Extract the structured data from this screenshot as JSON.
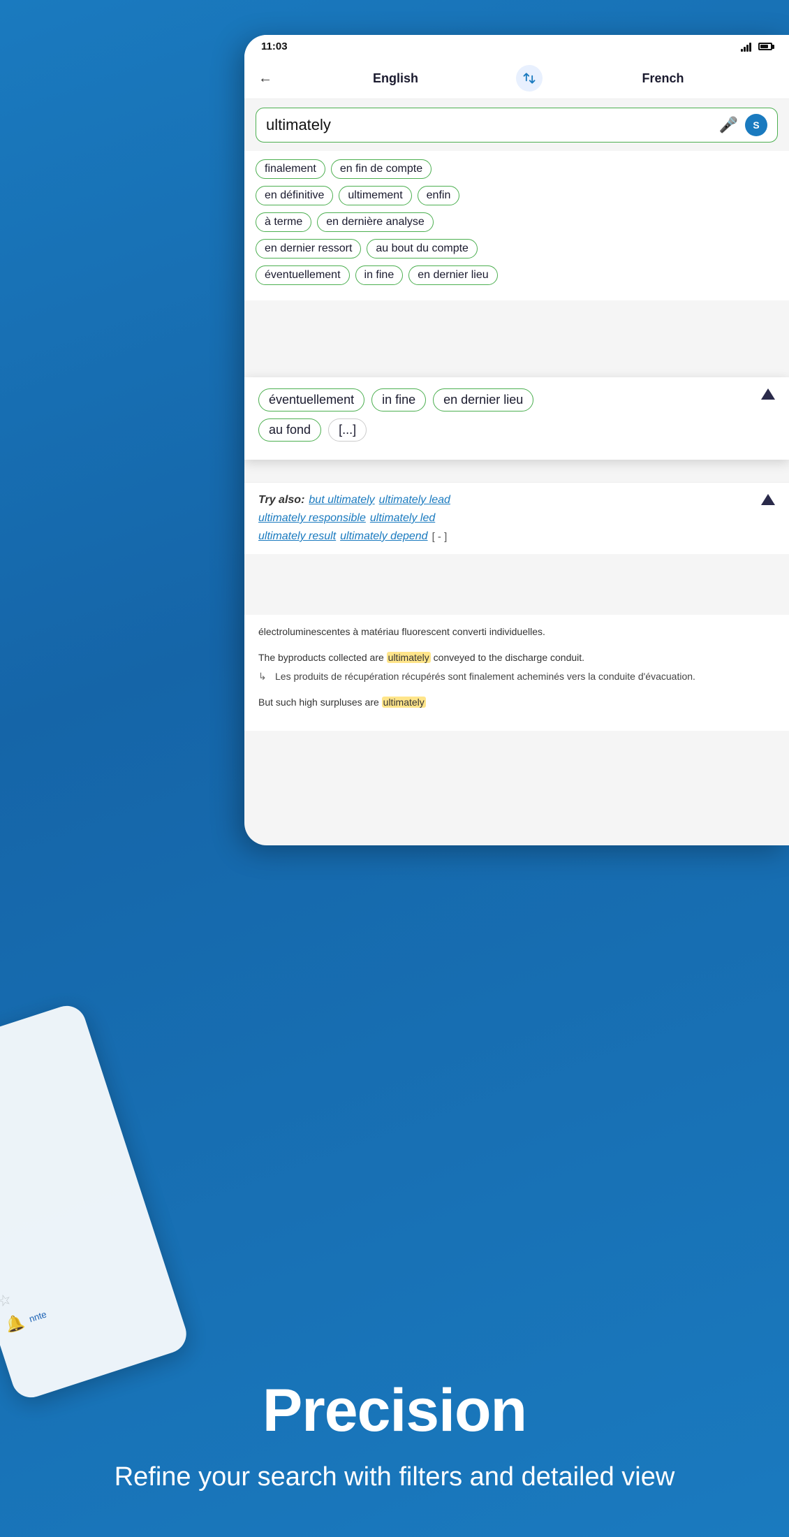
{
  "background": {
    "gradient_start": "#1a7abf",
    "gradient_end": "#1565a8"
  },
  "status_bar": {
    "time": "11:03",
    "signal": "signal-icon",
    "battery": "battery-icon"
  },
  "header": {
    "back_label": "←",
    "lang_from": "English",
    "swap_icon": "swap-icon",
    "lang_to": "French"
  },
  "search": {
    "query": "ultimately",
    "mic_icon": "mic-icon",
    "settings_icon": "S"
  },
  "translations": {
    "rows": [
      [
        "finalement",
        "en fin de compte"
      ],
      [
        "en définitive",
        "ultimement",
        "enfin"
      ],
      [
        "à terme",
        "en dernière analyse"
      ],
      [
        "en dernier ressort",
        "au bout du compte"
      ],
      [
        "éventuellement",
        "in fine",
        "en dernier lieu"
      ]
    ]
  },
  "expanded": {
    "row1": [
      "éventuellement",
      "in fine",
      "en dernier lieu"
    ],
    "row2": [
      "au fond",
      "[...]"
    ]
  },
  "try_also": {
    "label": "Try also:",
    "links": [
      "but ultimately",
      "ultimately lead",
      "ultimately responsible",
      "ultimately led",
      "ultimately result",
      "ultimately depend",
      "[ - ]"
    ]
  },
  "examples": [
    {
      "en": "électroluminescentes à matériau fluorescent converti individuelles.",
      "fr": ""
    },
    {
      "en": "The byproducts collected are ultimately conveyed to the discharge conduit.",
      "highlight": "ultimately",
      "fr": "Les produits de récupération récupérés sont finalement acheminés vers la conduite d'évacuation."
    },
    {
      "en": "But such high surpluses are ultimately",
      "highlight": "ultimately",
      "fr": ""
    }
  ],
  "bottom": {
    "title": "Precision",
    "description": "Refine your search with filters and detailed view"
  },
  "bg_phone": {
    "items": [
      {
        "icon": "star-icon",
        "text": ""
      },
      {
        "icon": "bell-icon",
        "text": ""
      },
      {
        "icon": "star-icon",
        "text": ""
      },
      {
        "icon": "bell-icon",
        "text": "nnte"
      }
    ]
  }
}
